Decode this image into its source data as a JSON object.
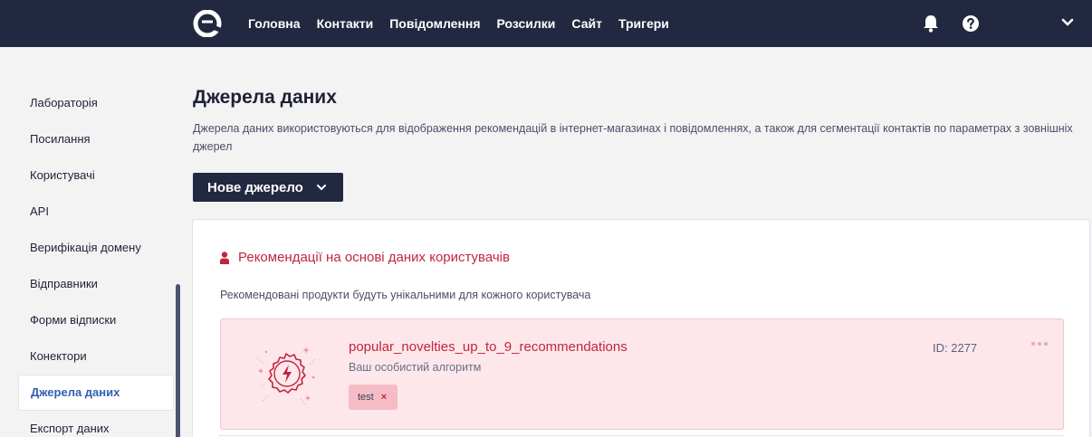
{
  "nav": {
    "items": [
      "Головна",
      "Контакти",
      "Повідомлення",
      "Розсилки",
      "Сайт",
      "Тригери"
    ]
  },
  "icons": {
    "logo": "brand-logo-icon",
    "bell": "bell-icon",
    "help": "help-circle-icon",
    "account_menu": "chevron-down-icon",
    "new_source_chevron": "chevron-down-icon",
    "section": "user-icon",
    "algorithm": "lightning-badge-icon",
    "item_menu": "ellipsis-icon",
    "tag_remove": "close-icon"
  },
  "sidebar": {
    "items": [
      {
        "label": "Лабораторія"
      },
      {
        "label": "Посилання"
      },
      {
        "label": "Користувачі"
      },
      {
        "label": "API"
      },
      {
        "label": "Верифікація домену"
      },
      {
        "label": "Відправники"
      },
      {
        "label": "Форми відписки"
      },
      {
        "label": "Конектори"
      },
      {
        "label": "Джерела даних",
        "active": true
      },
      {
        "label": "Експорт даних"
      }
    ]
  },
  "main": {
    "title": "Джерела даних",
    "description": "Джерела даних використовуються для відображення рекомендацій в інтернет-магазинах і повідомленнях, а також для сегментації контактів по параметрах з зовнішніх джерел",
    "new_source_label": "Нове джерело"
  },
  "section": {
    "title": "Рекомендації на основі даних користувачів",
    "description": "Рекомендовані продукти будуть унікальними для кожного користувача",
    "items": [
      {
        "name": "popular_novelties_up_to_9_recommendations",
        "subtitle": "Ваш особистий алгоритм",
        "tag": "test",
        "tag_remove": "×",
        "id_label": "ID: 2277"
      }
    ]
  },
  "colors": {
    "topbar": "#222840",
    "accent_red": "#c0263f",
    "active_link": "#2f5fb3",
    "item_bg": "#fde7ea",
    "tag_bg": "#f6bcc6"
  }
}
